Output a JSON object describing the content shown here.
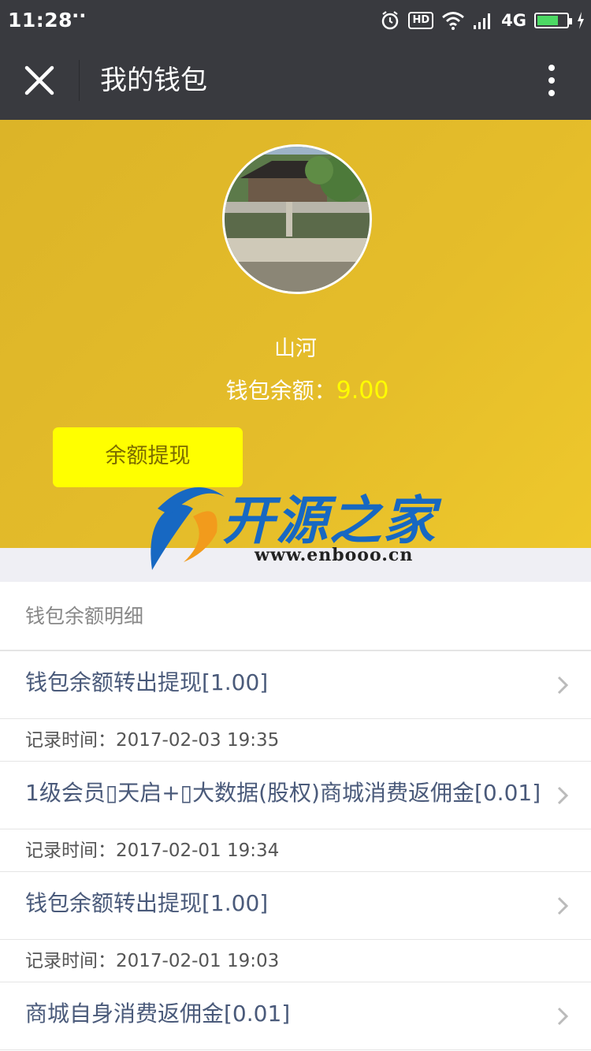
{
  "status_bar": {
    "time": "11:28",
    "dots": "···",
    "hd": "HD",
    "network": "4G"
  },
  "nav": {
    "title": "我的钱包",
    "close_icon": "close-icon",
    "more_icon": "more-vertical-icon"
  },
  "profile": {
    "username": "山河",
    "balance_label": "钱包余额：",
    "balance_value": "9.00",
    "withdraw_label": "余额提现"
  },
  "watermark": {
    "text": "开源之家",
    "url": "www.enbooo.cn"
  },
  "details": {
    "header": "钱包余额明细",
    "entries": [
      {
        "title": "钱包余额转出提现[1.00]",
        "time": "记录时间：2017-02-03 19:35"
      },
      {
        "title": "1级会员▯天启+▯大数据(股权)商城消费返佣金[0.01]",
        "time": "记录时间：2017-02-01 19:34"
      },
      {
        "title": "钱包余额转出提现[1.00]",
        "time": "记录时间：2017-02-01 19:03"
      },
      {
        "title": "商城自身消费返佣金[0.01]",
        "time": ""
      }
    ]
  },
  "colors": {
    "nav_bg": "#393a3f",
    "hero_bg": "#e5bd2a",
    "button_bg": "#ffff00",
    "amount": "#ffff00",
    "link_text": "#4a5a7a"
  }
}
